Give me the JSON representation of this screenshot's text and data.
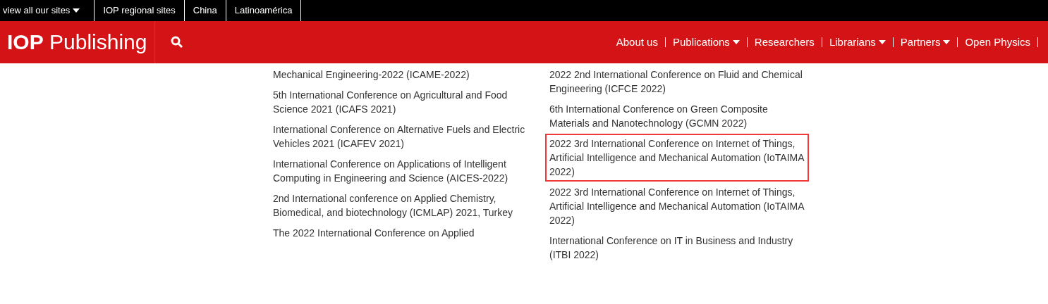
{
  "top_bar": {
    "sites_menu": {
      "label": "view all our sites",
      "has_menu": true
    },
    "links": [
      "IOP regional sites",
      "China",
      "Latinoamérica"
    ]
  },
  "header": {
    "logo": {
      "bold": "IOP",
      "rest": "Publishing"
    },
    "nav": [
      {
        "label": "About us",
        "has_menu": false
      },
      {
        "label": "Publications",
        "has_menu": true
      },
      {
        "label": "Researchers",
        "has_menu": false
      },
      {
        "label": "Librarians",
        "has_menu": true
      },
      {
        "label": "Partners",
        "has_menu": true
      },
      {
        "label": "Open Physics",
        "has_menu": false
      }
    ]
  },
  "columns": [
    [
      {
        "title": "Mechanical Engineering-2022 (ICAME-2022)",
        "highlighted": false
      },
      {
        "title": "5th International Conference on Agricultural and Food Science 2021 (ICAFS 2021)",
        "highlighted": false
      },
      {
        "title": "International Conference on Alternative Fuels and Electric Vehicles 2021 (ICAFEV 2021)",
        "highlighted": false
      },
      {
        "title": "International Conference on Applications of Intelligent Computing in Engineering and Science (AICES-2022)",
        "highlighted": false
      },
      {
        "title": "2nd International conference on Applied Chemistry, Biomedical, and biotechnology (ICMLAP) 2021, Turkey",
        "highlighted": false
      },
      {
        "title": "The 2022 International Conference on Applied",
        "highlighted": false
      }
    ],
    [
      {
        "title": "2022 2nd International Conference on Fluid and Chemical Engineering (ICFCE 2022)",
        "highlighted": false
      },
      {
        "title": "6th International Conference on Green Composite Materials and Nanotechnology (GCMN 2022)",
        "highlighted": false
      },
      {
        "title": "2022 3rd International Conference on Internet of Things, Artificial Intelligence and Mechanical Automation (IoTAIMA 2022)",
        "highlighted": true
      },
      {
        "title": "2022 3rd International Conference on Internet of Things, Artificial Intelligence and Mechanical Automation (IoTAIMA 2022)",
        "highlighted": false
      },
      {
        "title": "International Conference on IT in Business and Industry (ITBI 2022)",
        "highlighted": false
      }
    ]
  ]
}
